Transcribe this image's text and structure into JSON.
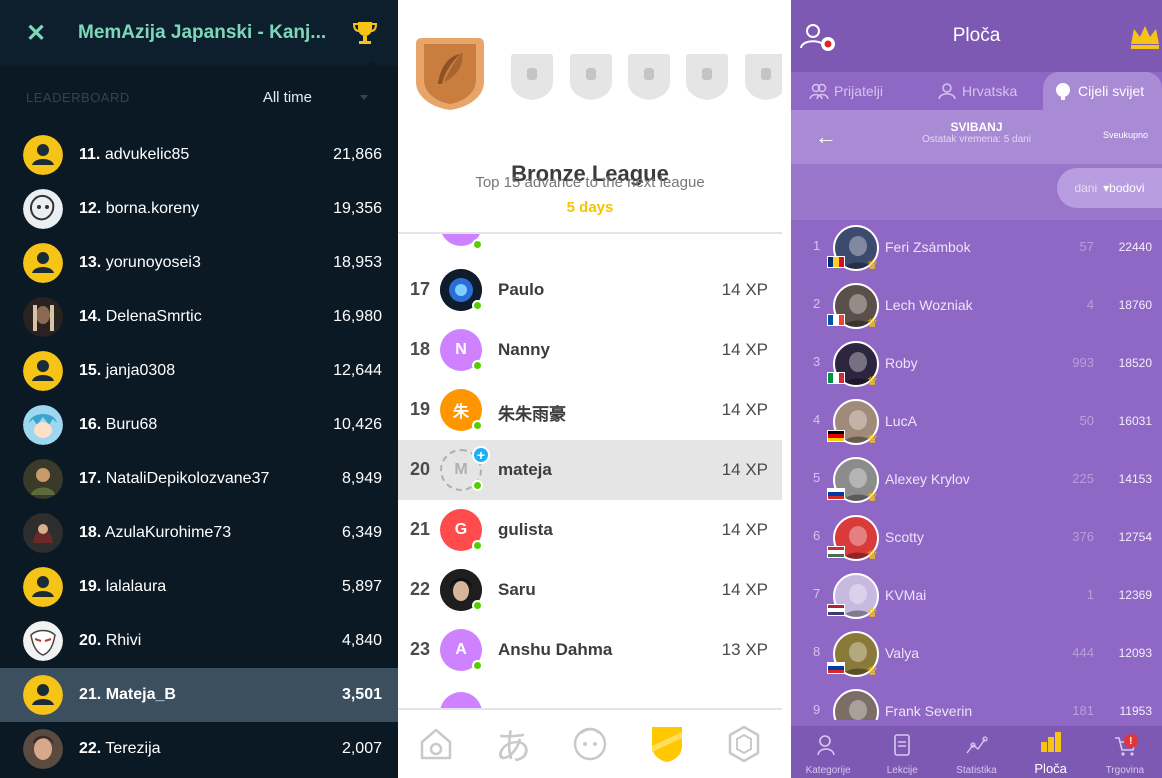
{
  "memazija": {
    "title": "MemAzija Japanski - Kanj...",
    "section_label": "LEADERBOARD",
    "filter": "All time",
    "rows": [
      {
        "rank": "11.",
        "name": "advukelic85",
        "score": "21,866",
        "avatar": "yellow"
      },
      {
        "rank": "12.",
        "name": "borna.koreny",
        "score": "19,356",
        "avatar": "sketch"
      },
      {
        "rank": "13.",
        "name": "yorunoyosei3",
        "score": "18,953",
        "avatar": "yellow"
      },
      {
        "rank": "14.",
        "name": "DelenaSmrtic",
        "score": "16,980",
        "avatar": "dark"
      },
      {
        "rank": "15.",
        "name": "janja0308",
        "score": "12,644",
        "avatar": "yellow"
      },
      {
        "rank": "16.",
        "name": "Buru68",
        "score": "10,426",
        "avatar": "anime"
      },
      {
        "rank": "17.",
        "name": "NataliDepikolozvane37",
        "score": "8,949",
        "avatar": "dark2"
      },
      {
        "rank": "18.",
        "name": "AzulaKurohime73",
        "score": "6,349",
        "avatar": "dark3"
      },
      {
        "rank": "19.",
        "name": "lalalaura",
        "score": "5,897",
        "avatar": "yellow"
      },
      {
        "rank": "20.",
        "name": "Rhivi",
        "score": "4,840",
        "avatar": "mask"
      },
      {
        "rank": "21.",
        "name": "Mateja_B",
        "score": "3,501",
        "avatar": "yellow",
        "me": true
      },
      {
        "rank": "22.",
        "name": "Terezija",
        "score": "2,007",
        "avatar": "photo"
      }
    ]
  },
  "duolingo": {
    "league": "Bronze League",
    "advance": "Top 15 advance to the next league",
    "days": "5 days",
    "rows": [
      {
        "rank": "17",
        "name": "Paulo",
        "xp": "14 XP",
        "letter": "",
        "color": "#1c2b3a"
      },
      {
        "rank": "18",
        "name": "Nanny",
        "xp": "14 XP",
        "letter": "N",
        "color": "#ce82ff"
      },
      {
        "rank": "19",
        "name": "朱朱雨豪",
        "xp": "14 XP",
        "letter": "朱",
        "color": "#ff9600"
      },
      {
        "rank": "20",
        "name": "mateja",
        "xp": "14 XP",
        "letter": "M",
        "color": "none",
        "me": true
      },
      {
        "rank": "21",
        "name": "gulista",
        "xp": "14 XP",
        "letter": "G",
        "color": "#ff4b4b"
      },
      {
        "rank": "22",
        "name": "Saru",
        "xp": "14 XP",
        "letter": "",
        "color": "#2b2b2b"
      },
      {
        "rank": "23",
        "name": "Anshu Dahma",
        "xp": "13 XP",
        "letter": "A",
        "color": "#ce82ff"
      }
    ],
    "nav": [
      "home-icon",
      "hiragana-icon",
      "profile-icon",
      "leagues-icon",
      "store-icon"
    ],
    "nav_glyphs": [
      "",
      "あ",
      "",
      "",
      ""
    ]
  },
  "ploca": {
    "title": "Ploča",
    "tabs": [
      "Prijatelji",
      "Hrvatska",
      "Cijeli svijet"
    ],
    "month": "SVIBANJ",
    "remaining": "Ostatak vremena: 5 dani",
    "total_label": "Sveukupno",
    "sort_days": "dani",
    "sort_points": "▾bodovi",
    "rows": [
      {
        "rank": "1",
        "name": "Feri Zsámbok",
        "days": "57",
        "points": "22440",
        "flag": "ro",
        "avatar": "#3c4a6e"
      },
      {
        "rank": "2",
        "name": "Lech Wozniak",
        "days": "4",
        "points": "18760",
        "flag": "fr",
        "avatar": "#5b4f4a"
      },
      {
        "rank": "3",
        "name": "Roby",
        "days": "993",
        "points": "18520",
        "flag": "it",
        "avatar": "#2d2540"
      },
      {
        "rank": "4",
        "name": "LucA",
        "days": "50",
        "points": "16031",
        "flag": "de",
        "avatar": "#a08b7a"
      },
      {
        "rank": "5",
        "name": "Alexey Krylov",
        "days": "225",
        "points": "14153",
        "flag": "ru",
        "avatar": "#8c8c8c"
      },
      {
        "rank": "6",
        "name": "Scotty",
        "days": "376",
        "points": "12754",
        "flag": "hu",
        "avatar": "#d93b3b"
      },
      {
        "rank": "7",
        "name": "KVMai",
        "days": "1",
        "points": "12369",
        "flag": "us",
        "avatar": "#c7b9e0"
      },
      {
        "rank": "8",
        "name": "Valya",
        "days": "444",
        "points": "12093",
        "flag": "ru",
        "avatar": "#8a7a3a"
      },
      {
        "rank": "9",
        "name": "Frank Severin",
        "days": "181",
        "points": "11953",
        "flag": "de",
        "avatar": "#7c6d66"
      }
    ],
    "nav": [
      {
        "label": "Kategorije",
        "icon": "categories-icon"
      },
      {
        "label": "Lekcije",
        "icon": "lessons-icon"
      },
      {
        "label": "Statistika",
        "icon": "statistics-icon"
      },
      {
        "label": "Ploča",
        "icon": "board-icon",
        "active": true
      },
      {
        "label": "Trgovina",
        "icon": "shop-icon",
        "badge": "!"
      }
    ]
  }
}
